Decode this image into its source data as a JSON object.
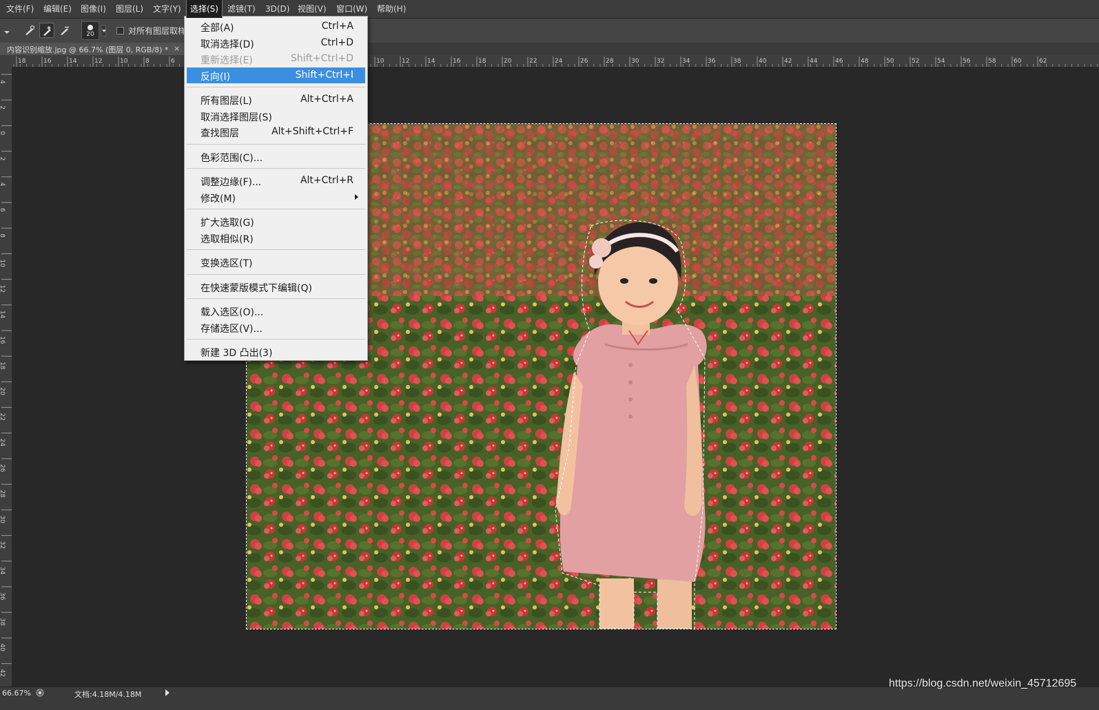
{
  "menubar": {
    "items": [
      "文件(F)",
      "编辑(E)",
      "图像(I)",
      "图层(L)",
      "文字(Y)",
      "选择(S)",
      "滤镜(T)",
      "3D(D)",
      "视图(V)",
      "窗口(W)",
      "帮助(H)"
    ],
    "active_index": 5
  },
  "options_bar": {
    "brush_size": "20",
    "sample_all_layers_label": "对所有图层取样",
    "sample_all_layers_checked": false,
    "tool_icons": [
      "dropdown-caret-icon",
      "quick-select-new-icon",
      "quick-select-add-icon",
      "quick-select-subtract-icon"
    ]
  },
  "document": {
    "tab_title": "内容识别缩放.jpg @ 66.7% (图层 0, RGB/8) *",
    "tab_close": "×"
  },
  "rulers": {
    "top": [
      "18",
      "16",
      "14",
      "12",
      "10",
      "8",
      "6",
      "10",
      "12",
      "14",
      "16",
      "18",
      "20",
      "22",
      "24",
      "26",
      "28",
      "30",
      "32",
      "34",
      "36",
      "38",
      "40",
      "42",
      "44",
      "46",
      "48",
      "50",
      "52",
      "54",
      "56",
      "58",
      "60",
      "62"
    ],
    "left": [
      "4",
      "2",
      "0",
      "2",
      "4",
      "6",
      "8",
      "10",
      "12",
      "14",
      "16",
      "18",
      "20",
      "22",
      "24",
      "26",
      "28",
      "30",
      "32",
      "34",
      "36",
      "38",
      "40",
      "42"
    ]
  },
  "select_menu": {
    "groups": [
      [
        {
          "label": "全部(A)",
          "shortcut": "Ctrl+A"
        },
        {
          "label": "取消选择(D)",
          "shortcut": "Ctrl+D"
        },
        {
          "label": "重新选择(E)",
          "shortcut": "Shift+Ctrl+D",
          "disabled": true
        },
        {
          "label": "反向(I)",
          "shortcut": "Shift+Ctrl+I",
          "highlight": true
        }
      ],
      [
        {
          "label": "所有图层(L)",
          "shortcut": "Alt+Ctrl+A"
        },
        {
          "label": "取消选择图层(S)",
          "shortcut": ""
        },
        {
          "label": "查找图层",
          "shortcut": "Alt+Shift+Ctrl+F"
        }
      ],
      [
        {
          "label": "色彩范围(C)...",
          "shortcut": ""
        }
      ],
      [
        {
          "label": "调整边缘(F)...",
          "shortcut": "Alt+Ctrl+R"
        },
        {
          "label": "修改(M)",
          "shortcut": "",
          "submenu": true
        }
      ],
      [
        {
          "label": "扩大选取(G)",
          "shortcut": ""
        },
        {
          "label": "选取相似(R)",
          "shortcut": ""
        }
      ],
      [
        {
          "label": "变换选区(T)",
          "shortcut": ""
        }
      ],
      [
        {
          "label": "在快速蒙版模式下编辑(Q)",
          "shortcut": ""
        }
      ],
      [
        {
          "label": "载入选区(O)...",
          "shortcut": ""
        },
        {
          "label": "存储选区(V)...",
          "shortcut": ""
        }
      ],
      [
        {
          "label": "新建 3D 凸出(3)",
          "shortcut": ""
        }
      ]
    ]
  },
  "statusbar": {
    "zoom": "66.67%",
    "doc_size": "文档:4.18M/4.18M"
  },
  "watermark": "https://blog.csdn.net/weixin_45712695",
  "colors": {
    "menu_highlight": "#3c8fe0",
    "workspace": "#282828",
    "dress_pink": "#e2a0a2",
    "flower_red": "#e0484a",
    "foliage_green": "#5a7a32"
  }
}
